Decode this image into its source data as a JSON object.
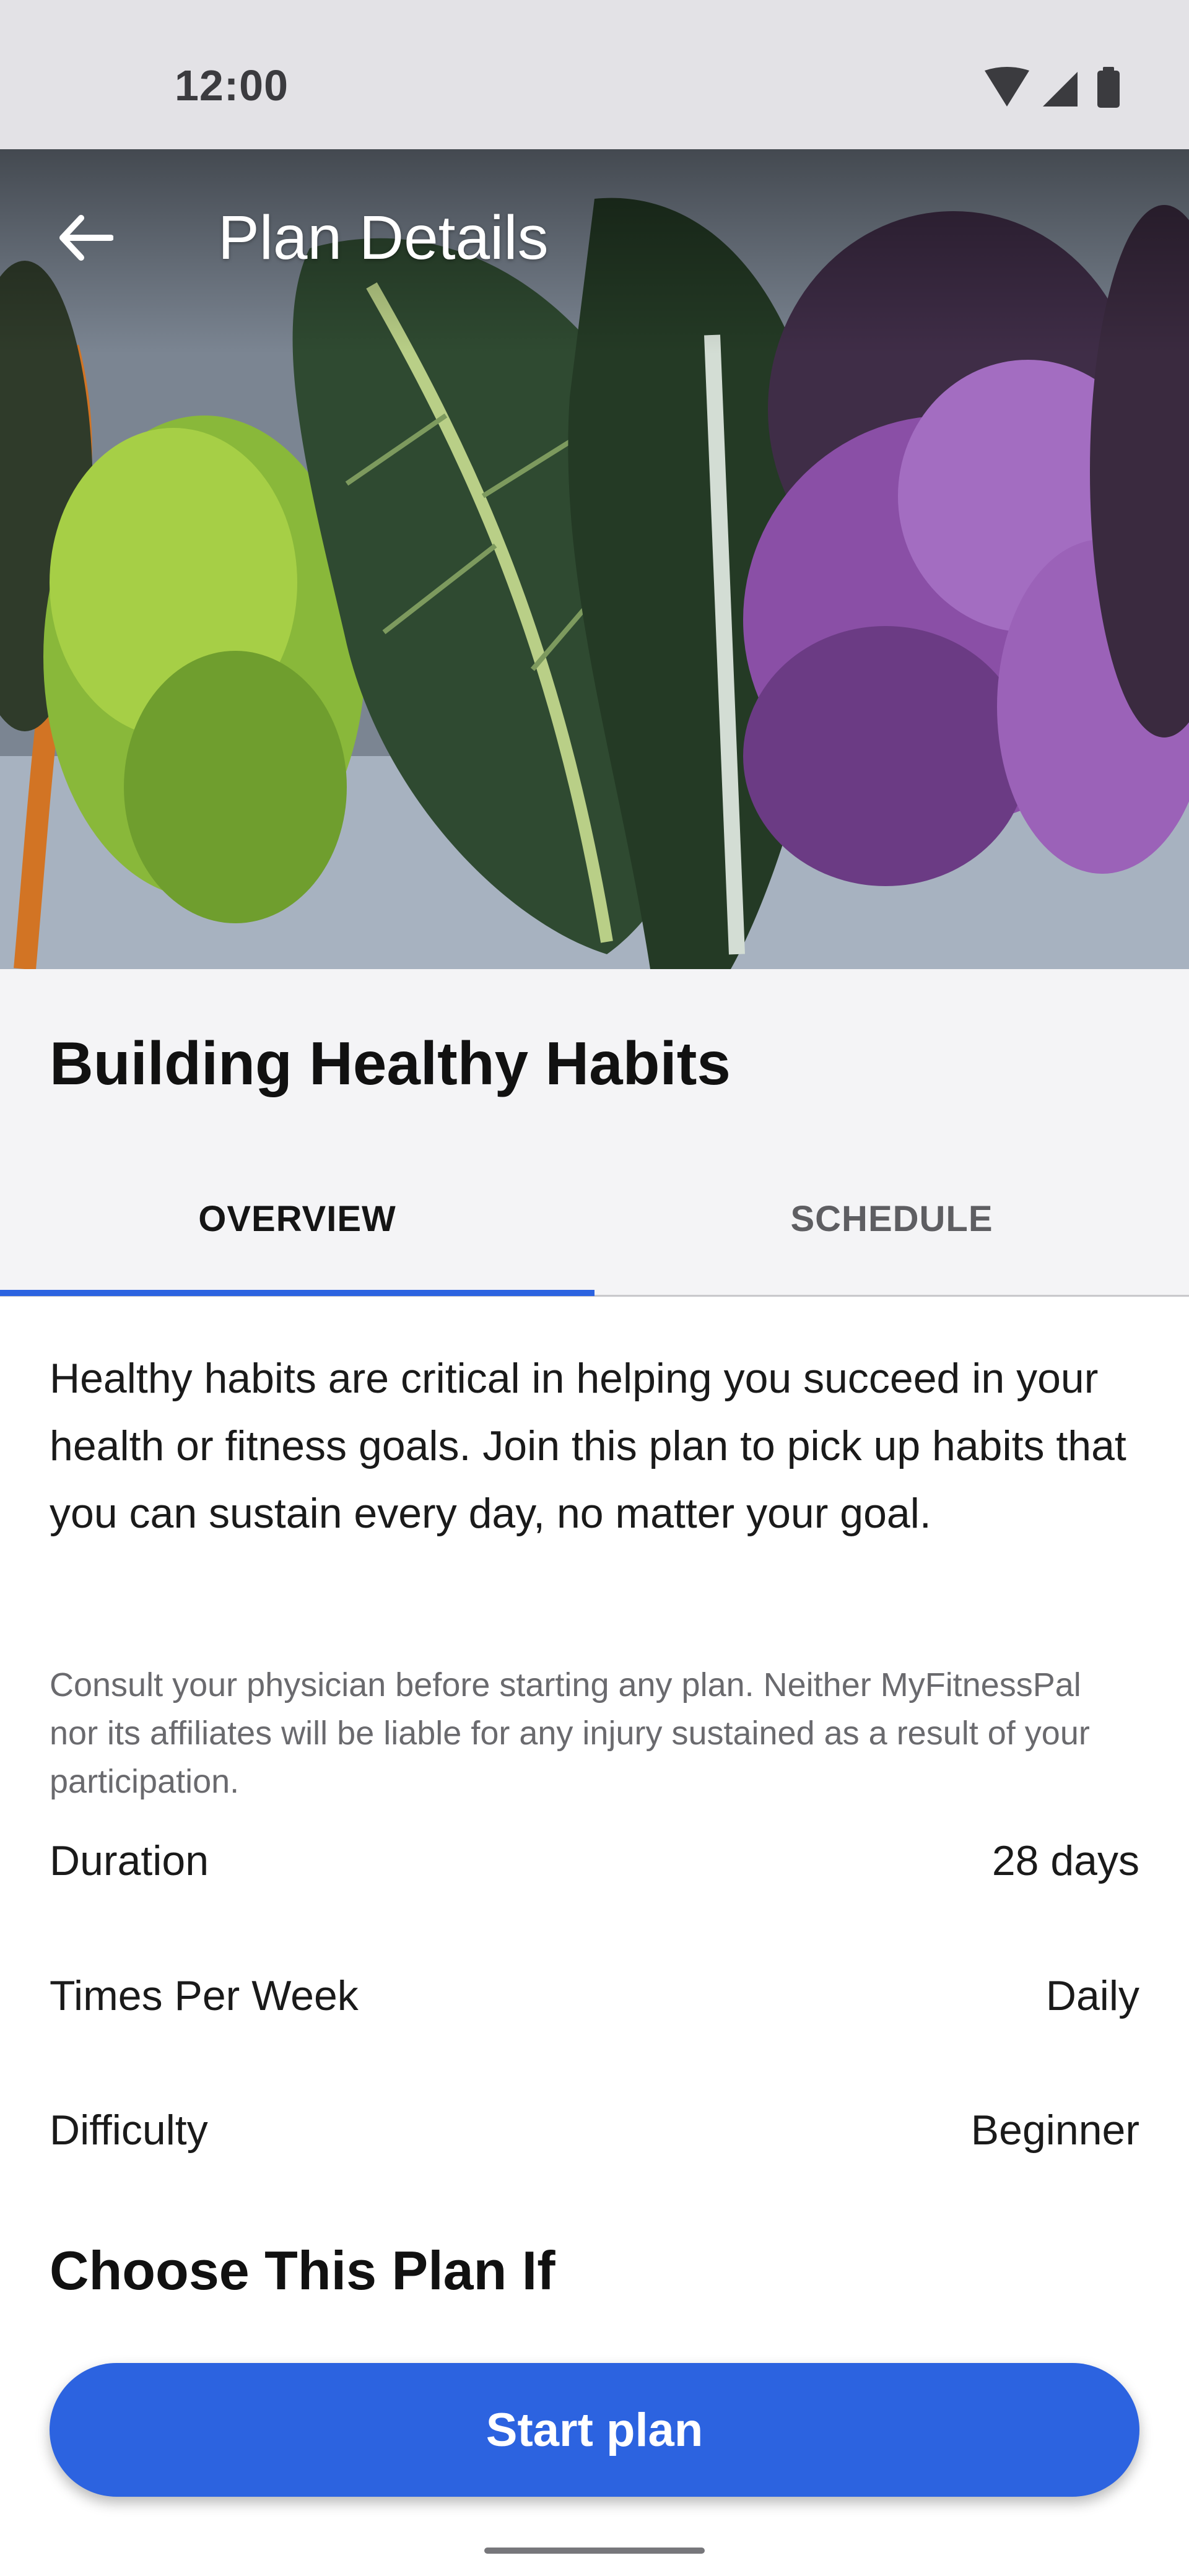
{
  "status_bar": {
    "time": "12:00",
    "icons": [
      "wifi-icon",
      "signal-icon",
      "battery-icon"
    ]
  },
  "app_bar": {
    "title": "Plan Details",
    "back_icon": "arrow-back-icon"
  },
  "plan": {
    "title": "Building Healthy Habits",
    "description": "Healthy habits are critical in helping you succeed in your health or fitness goals. Join this plan to pick up habits that you can sustain every day, no matter your goal.",
    "disclaimer": "Consult your physician before starting any plan. Neither MyFitnessPal nor its affiliates will be liable for any injury sustained as a result of your participation."
  },
  "tabs": [
    {
      "label": "OVERVIEW",
      "selected": true
    },
    {
      "label": "SCHEDULE",
      "selected": false
    }
  ],
  "details": [
    {
      "label": "Duration",
      "value": "28 days"
    },
    {
      "label": "Times Per Week",
      "value": "Daily"
    },
    {
      "label": "Difficulty",
      "value": "Beginner"
    }
  ],
  "section_heading": "Choose This Plan If",
  "start_button": {
    "label": "Start plan"
  },
  "colors": {
    "accent": "#2c63e0",
    "status_bar_bg": "#e3e2e6",
    "title_area_bg": "#f4f4f6"
  }
}
